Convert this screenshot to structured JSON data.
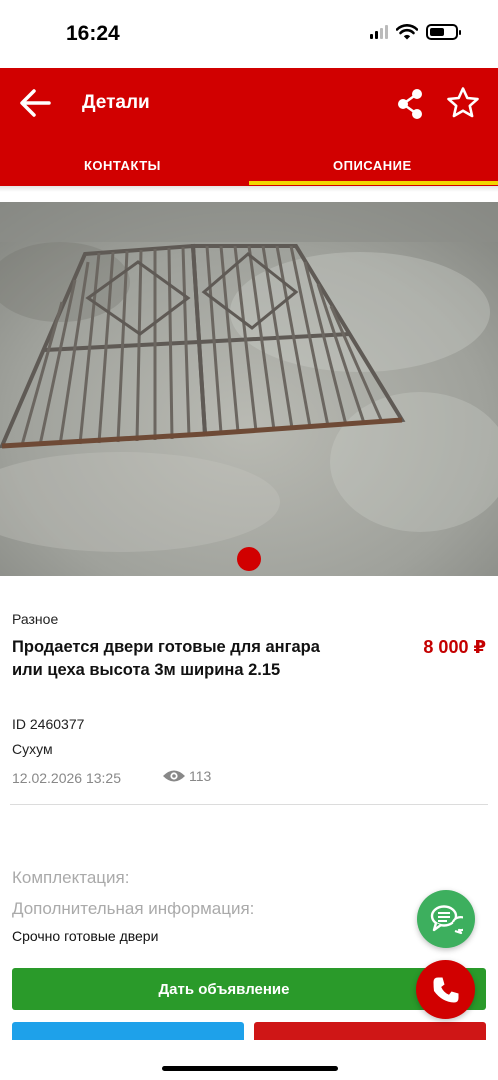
{
  "status_bar": {
    "time": "16:24",
    "icons": [
      "cellular-signal-icon",
      "wifi-icon",
      "battery-icon"
    ]
  },
  "header": {
    "title": "Детали",
    "back_icon": "arrow-left-icon",
    "share_icon": "share-icon",
    "favorite_icon": "star-outline-icon",
    "background_color": "#d10000"
  },
  "tabs": [
    {
      "label": "КОНТАКТЫ",
      "active": false
    },
    {
      "label": "ОПИСАНИЕ",
      "active": true
    }
  ],
  "tab_indicator_color": "#f2d600",
  "gallery": {
    "photo_description": "Metal gate frames lying on concrete",
    "current_page": 1,
    "page_count": 1
  },
  "listing": {
    "category": "Разное",
    "title": "Продается двери готовые для ангара или цеха высота 3м ширина 2.15",
    "price": "8 000 ₽",
    "id": "ID 2460377",
    "city": "Сухум",
    "date": "12.02.2026 13:25",
    "views": "113",
    "price_color": "#c40000"
  },
  "details": {
    "complectation_label": "Комплектация:",
    "extra_info_label": "Дополнительная информация:",
    "extra_info_text": "Срочно готовые двери"
  },
  "actions": {
    "post_ad": "Дать объявление",
    "post_ad_color": "#2a9a2a",
    "blue_button_color": "#1ea1ea",
    "red_button_color": "#cf1616",
    "chat_icon": "chat-bubbles-icon",
    "call_icon": "phone-icon"
  }
}
